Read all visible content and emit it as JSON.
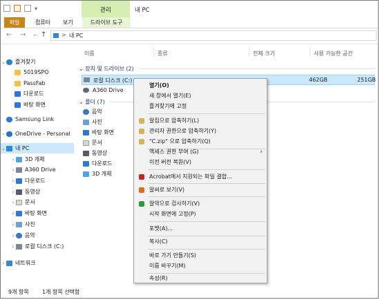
{
  "window": {
    "title": "내 PC",
    "context_group": "관리"
  },
  "ribbon": {
    "tabs": [
      "파일",
      "컴퓨터",
      "보기",
      "드라이브 도구"
    ]
  },
  "address": {
    "path_sep": ">",
    "path": "내 PC",
    "back": "←",
    "forward": "→",
    "recent": "⌄",
    "up": "↑"
  },
  "sidebar": {
    "items": [
      {
        "label": "즐겨찾기",
        "icon": "star-icon"
      },
      {
        "label": "5019SPO",
        "icon": "folder-icon"
      },
      {
        "label": "PassFab",
        "icon": "folder-icon"
      },
      {
        "label": "다운로드",
        "icon": "download-icon"
      },
      {
        "label": "바탕 화면",
        "icon": "desktop-icon"
      },
      {
        "label": "Samsung Link",
        "icon": "samsung-link-icon"
      },
      {
        "label": "OneDrive - Personal",
        "icon": "onedrive-icon"
      },
      {
        "label": "내 PC",
        "icon": "pc-icon"
      },
      {
        "label": "3D 개체",
        "icon": "3d-objects-icon"
      },
      {
        "label": "A360 Drive",
        "icon": "a360-icon"
      },
      {
        "label": "다운로드",
        "icon": "download-icon"
      },
      {
        "label": "동영상",
        "icon": "video-icon"
      },
      {
        "label": "문서",
        "icon": "document-icon"
      },
      {
        "label": "바탕 화면",
        "icon": "desktop-icon"
      },
      {
        "label": "사진",
        "icon": "pictures-icon"
      },
      {
        "label": "음악",
        "icon": "music-icon"
      },
      {
        "label": "로컬 디스크 (C:)",
        "icon": "drive-icon"
      },
      {
        "label": "네트워크",
        "icon": "network-icon"
      }
    ]
  },
  "columns": [
    "이름",
    "종류",
    "전체 크기",
    "사용 가능한 공간"
  ],
  "groups": {
    "drives": "장치 및 드라이브 (2)",
    "folders": "폴더 (7)"
  },
  "drives": [
    {
      "name": "로컬 디스크 (C:)",
      "total": "462GB",
      "free": "251GB"
    },
    {
      "name": "A360 Drive"
    }
  ],
  "folders": [
    "음악",
    "사진",
    "바탕 화면",
    "문서",
    "동영상",
    "다운로드",
    "3D 개체"
  ],
  "context_menu": {
    "items": [
      "열기(O)",
      "새 창에서 열기(E)",
      "즐겨찾기에 고정",
      "알집으로 압축하기(L)",
      "관리자 권한으로 압축하기(Y)",
      "\"C.zip\" 으로 압축하기(Q)",
      "액세스 권한 부여 (G)",
      "이전 버전 복원(V)",
      "Acrobat에서 지원되는 파일 결합...",
      "알씨로 보기(V)",
      "알약으로 검사하기(V)",
      "시작 화면에 고정(P)",
      "포맷(A)...",
      "복사(C)",
      "바로 가기 만들기(S)",
      "이름 바꾸기(M)",
      "속성(R)"
    ],
    "submenu_arrow": "›"
  },
  "status": {
    "count": "9개 항목",
    "selected": "1개 항목 선택함"
  },
  "colors": {
    "file_tab": "#c6861b",
    "context_tab": "#d5eeb4",
    "selection": "#cce8ff",
    "group_text": "#1e3287"
  }
}
